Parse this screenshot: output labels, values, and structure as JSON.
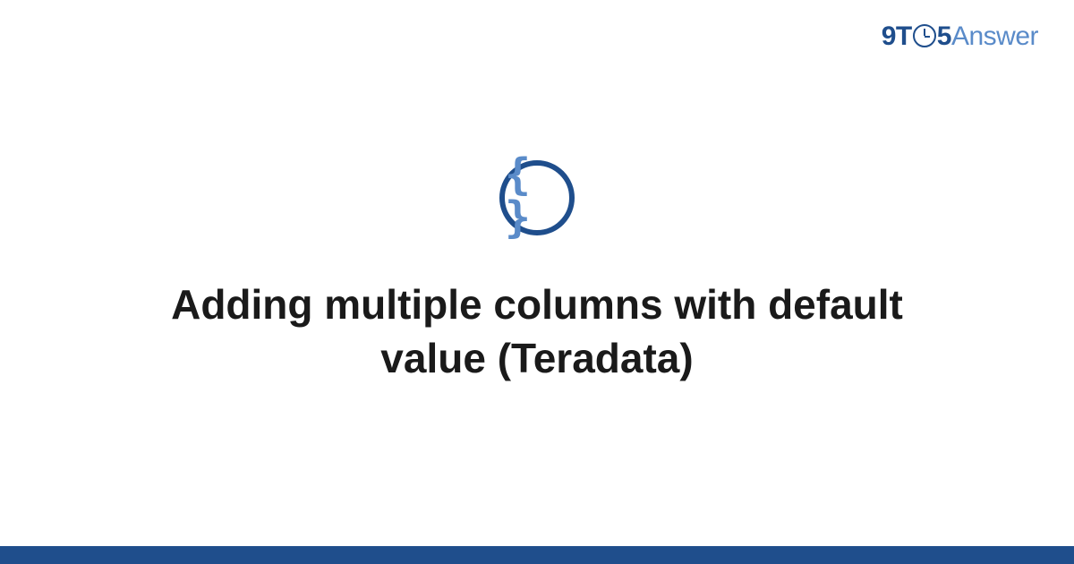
{
  "logo": {
    "part1": "9T",
    "part2": "5",
    "part3": "Answer"
  },
  "icon": {
    "braces": "{ }"
  },
  "title": "Adding multiple columns with default value (Teradata)",
  "colors": {
    "primary": "#1f4e8c",
    "secondary": "#5a8bc9",
    "text": "#1a1a1a"
  }
}
